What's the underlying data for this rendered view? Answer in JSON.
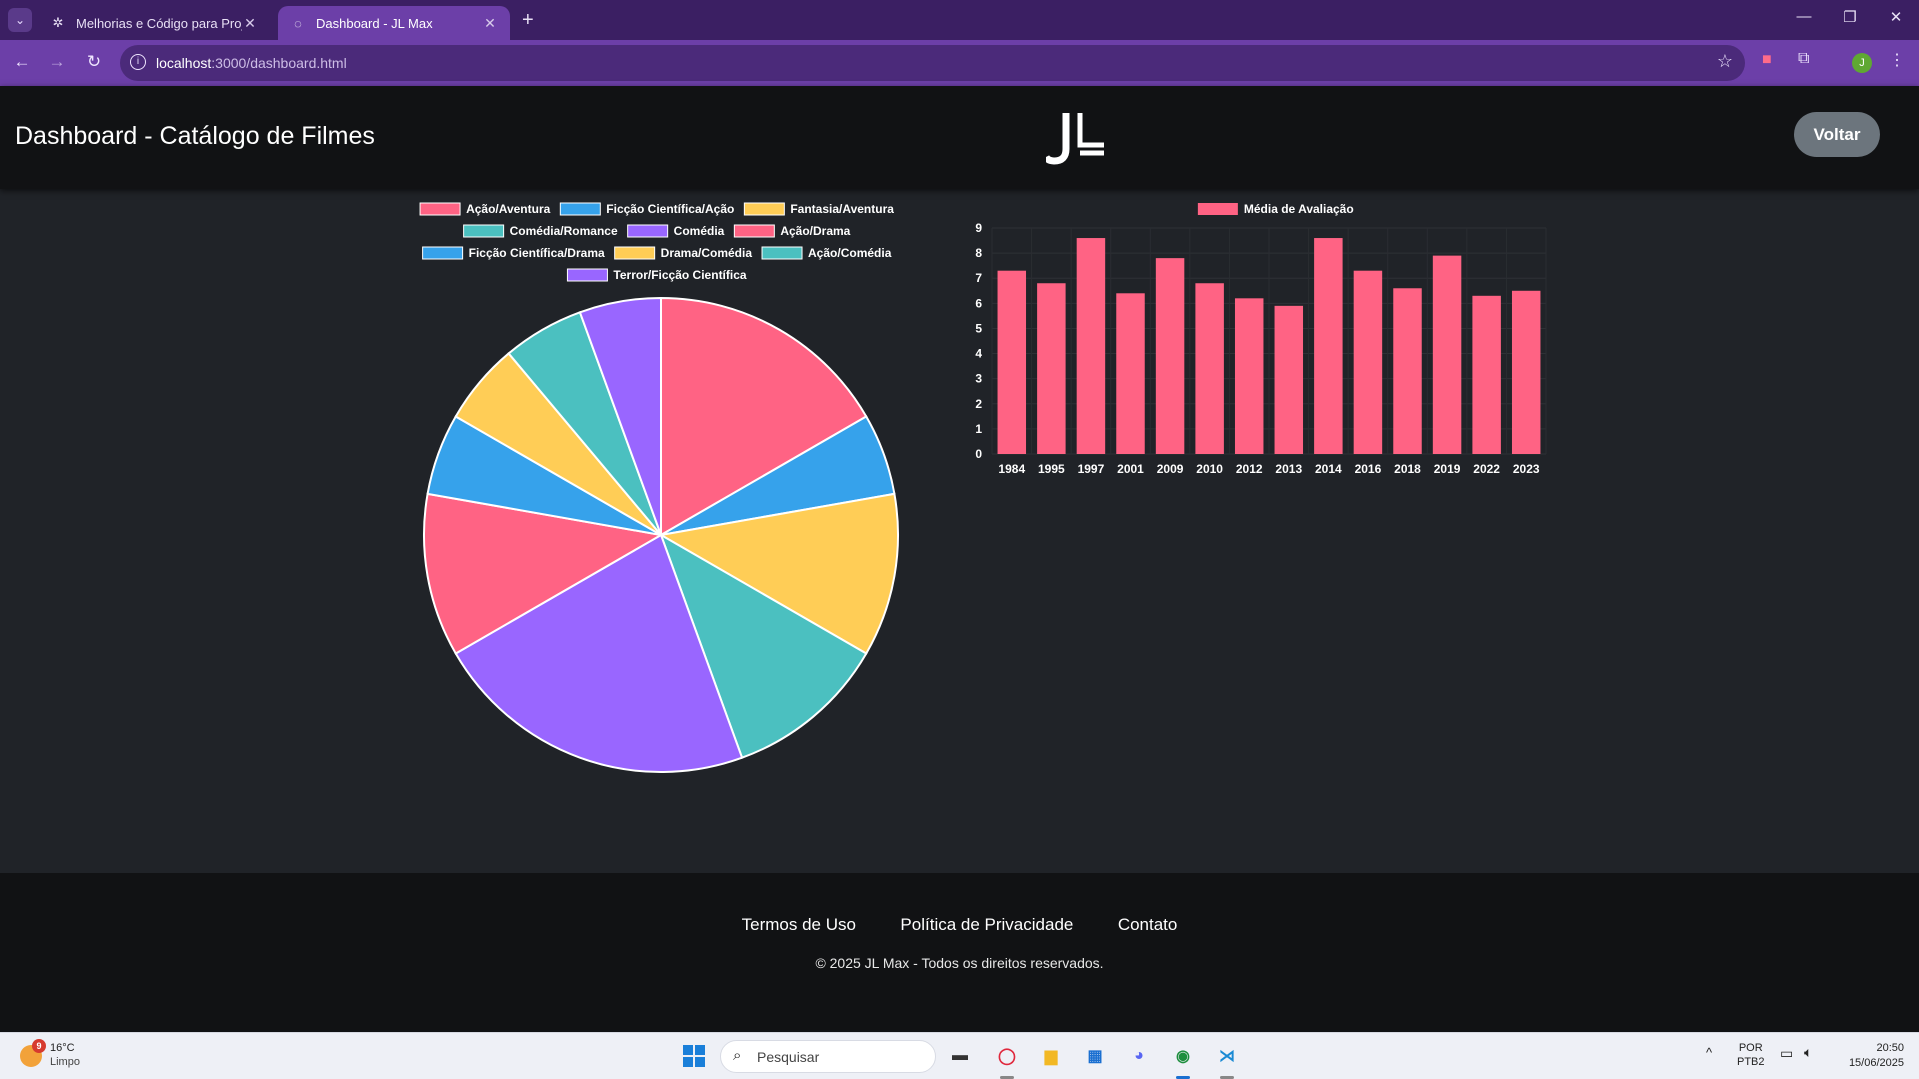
{
  "browser": {
    "tabs": [
      {
        "title": "Melhorias e Código para Projeto",
        "icon": "openai-icon",
        "active": false
      },
      {
        "title": "Dashboard - JL Max",
        "icon": "globe-icon",
        "active": true
      }
    ],
    "url_host": "localhost",
    "url_path": ":3000/dashboard.html",
    "accent": "#6c3fa8",
    "tab_strip_color": "#3b1f63"
  },
  "header": {
    "title": "Dashboard - Catálogo de Filmes",
    "logo_text": "JL",
    "back_button": "Voltar"
  },
  "chart_data": [
    {
      "type": "pie",
      "legend_position": "top",
      "categories": [
        "Ação/Aventura",
        "Ficção Científica/Ação",
        "Fantasia/Aventura",
        "Comédia/Romance",
        "Comédia",
        "Ação/Drama",
        "Ficção Científica/Drama",
        "Drama/Comédia",
        "Ação/Comédia",
        "Terror/Ficção Científica"
      ],
      "values": [
        3,
        1,
        2,
        2,
        4,
        2,
        1,
        1,
        1,
        1
      ],
      "colors": [
        "#ff6384",
        "#36a2eb",
        "#ffcd56",
        "#4bc0c0",
        "#9966ff",
        "#ff6384",
        "#36a2eb",
        "#ffcd56",
        "#4bc0c0",
        "#9966ff"
      ]
    },
    {
      "type": "bar",
      "legend_position": "top",
      "categories": [
        "1984",
        "1995",
        "1997",
        "2001",
        "2009",
        "2010",
        "2012",
        "2013",
        "2014",
        "2016",
        "2018",
        "2019",
        "2022",
        "2023"
      ],
      "series": [
        {
          "name": "Média de Avaliação",
          "color": "#ff6384",
          "values": [
            7.3,
            6.8,
            8.6,
            6.4,
            7.8,
            6.8,
            6.2,
            5.9,
            8.6,
            7.3,
            6.6,
            7.9,
            6.3,
            6.5
          ]
        }
      ],
      "ylim": [
        0,
        9
      ],
      "yticks": [
        "0",
        "1",
        "2",
        "3",
        "4",
        "5",
        "6",
        "7",
        "8",
        "9"
      ],
      "grid": true
    }
  ],
  "footer": {
    "links": [
      "Termos de Uso",
      "Política de Privacidade",
      "Contato"
    ],
    "copyright": "© 2025 JL Max - Todos os direitos reservados."
  },
  "taskbar": {
    "weather_temp": "16°C",
    "weather_cond": "Limpo",
    "weather_badge": "9",
    "search_placeholder": "Pesquisar",
    "lang_line1": "POR",
    "lang_line2": "PTB2",
    "time": "20:50",
    "date": "15/06/2025",
    "apps": [
      "file-explorer-icon",
      "opera-icon",
      "folder-icon",
      "store-icon",
      "discord-icon",
      "chrome-icon",
      "vscode-icon"
    ]
  }
}
